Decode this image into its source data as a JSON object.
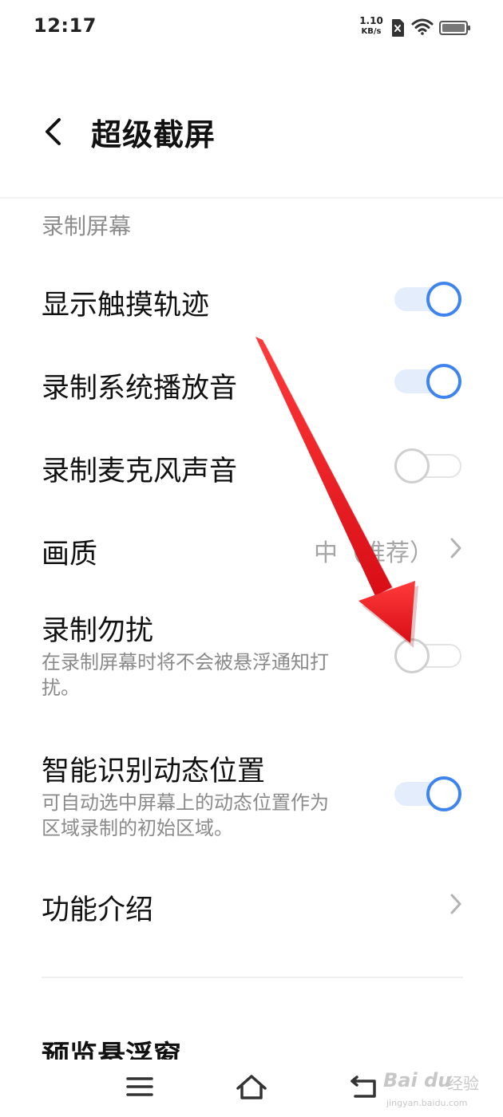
{
  "status_bar": {
    "time": "12:17",
    "net_speed_value": "1.10",
    "net_speed_unit": "KB/s",
    "icons": [
      "sim-card-off-icon",
      "wifi-icon",
      "battery-icon"
    ]
  },
  "header": {
    "title": "超级截屏"
  },
  "section": {
    "title": "录制屏幕"
  },
  "settings": {
    "show_touch": {
      "label": "显示触摸轨迹",
      "enabled": true
    },
    "system_audio": {
      "label": "录制系统播放音",
      "enabled": true
    },
    "mic_audio": {
      "label": "录制麦克风声音",
      "enabled": false
    },
    "quality": {
      "label": "画质",
      "value": "中（推荐）"
    },
    "dnd": {
      "label": "录制勿扰",
      "description": "在录制屏幕时将不会被悬浮通知打扰。",
      "enabled": false
    },
    "smart_detect": {
      "label": "智能识别动态位置",
      "description": "可自动选中屏幕上的动态位置作为区域录制的初始区域。",
      "enabled": true
    },
    "intro": {
      "label": "功能介绍"
    }
  },
  "next_section": {
    "title": "预览悬浮窗"
  },
  "nav_bar": {
    "icons": [
      "menu-icon",
      "home-icon",
      "back-nav-icon"
    ]
  },
  "watermark": {
    "brand": "Bai du",
    "cn": "经验",
    "url": "jingyan.baidu.com"
  },
  "colors": {
    "accent": "#3d84ee",
    "toggle_track_on": "#e3edfc",
    "arrow": "#e8101a"
  }
}
